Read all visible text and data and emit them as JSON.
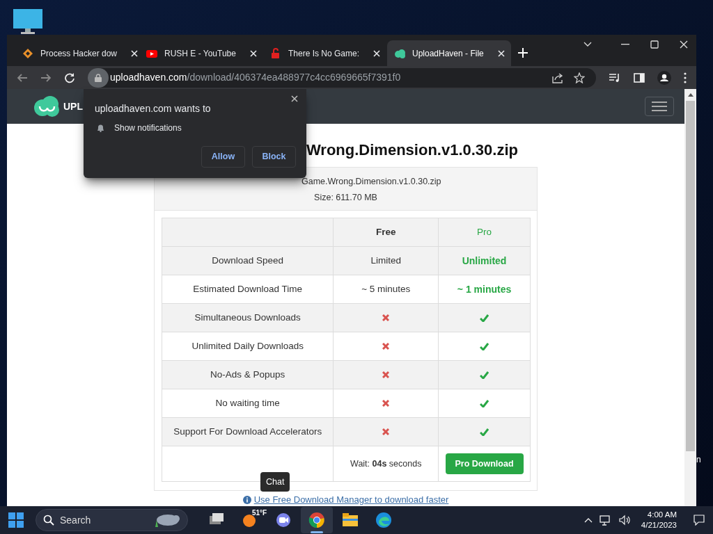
{
  "desktop": {
    "labels": [
      "n"
    ]
  },
  "browser": {
    "tabs": [
      {
        "title": "Process Hacker dow",
        "selected": false
      },
      {
        "title": "RUSH E - YouTube",
        "selected": false
      },
      {
        "title": "There Is No Game:",
        "selected": false
      },
      {
        "title": "UploadHaven - File",
        "selected": true
      }
    ],
    "address": {
      "host": "uploadhaven.com",
      "path": "/download/406374ea488977c4cc6969665f7391f0"
    }
  },
  "site": {
    "logo_text": "UPL"
  },
  "permission_prompt": {
    "title": "uploadhaven.com wants to",
    "permission": "Show notifications",
    "buttons": [
      "Allow",
      "Block"
    ]
  },
  "file": {
    "title": "Wrong.Dimension.v1.0.30.zip",
    "name": "Game.Wrong.Dimension.v1.0.30.zip",
    "size": "Size: 611.70 MB"
  },
  "table": {
    "columns": [
      "",
      "Free",
      "Pro"
    ],
    "rows": [
      {
        "kind": "text",
        "feature": "Download Speed",
        "free": "Limited",
        "pro": "Unlimited"
      },
      {
        "kind": "text",
        "feature": "Estimated Download Time",
        "free": "~ 5 minutes",
        "pro": "~ 1 minutes"
      },
      {
        "kind": "boolean",
        "feature": "Simultaneous Downloads",
        "free": false,
        "pro": true
      },
      {
        "kind": "boolean",
        "feature": "Unlimited Daily Downloads",
        "free": false,
        "pro": true
      },
      {
        "kind": "boolean",
        "feature": "No-Ads & Popups",
        "free": false,
        "pro": true
      },
      {
        "kind": "boolean",
        "feature": "No waiting time",
        "free": false,
        "pro": true
      },
      {
        "kind": "boolean",
        "feature": "Support For Download Accelerators",
        "free": false,
        "pro": true
      }
    ],
    "footer": {
      "wait": "Wait: **04s** seconds",
      "button": "Pro Download"
    }
  },
  "link": "Use Free Download Manager to download faster",
  "taskbar": {
    "search": "Search",
    "weather": "51°F",
    "tooltip": "Chat",
    "apps": [
      {
        "kind": "taskview",
        "selected": false
      },
      {
        "kind": "weather",
        "selected": false
      },
      {
        "kind": "chat",
        "selected": false
      },
      {
        "kind": "chrome",
        "selected": true
      },
      {
        "kind": "files",
        "selected": false
      },
      {
        "kind": "edge",
        "selected": false
      }
    ],
    "time": "4:00 AM",
    "date": "4/21/2023"
  }
}
